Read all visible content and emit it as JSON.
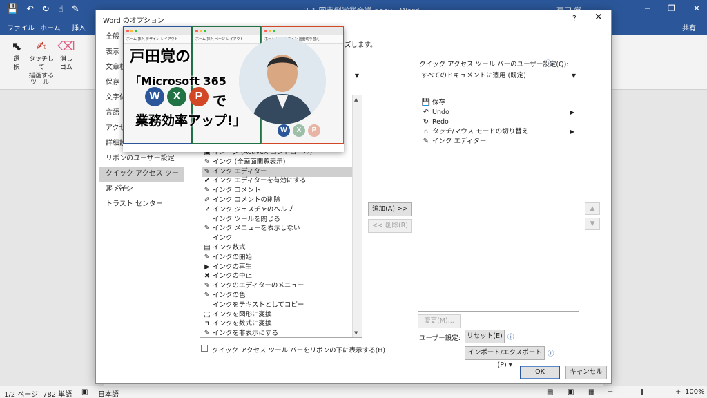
{
  "titlebar": {
    "doc_title": "3-1 回実例営業会議.docx - Word",
    "user_name": "戸田 覚",
    "minimize_icon": "─",
    "restore_icon": "❐",
    "close_icon": "✕"
  },
  "tabs": {
    "file": "ファイル",
    "home": "ホーム",
    "insert": "挿入",
    "share": "共有"
  },
  "ribbon": {
    "select_label": "選\n択",
    "draw_touch_label": "タッチして\n描画する",
    "eraser_label": "消し\nゴム",
    "group_tools": "ツール"
  },
  "statusbar": {
    "page": "1/2 ページ",
    "words": "782 単語",
    "lang": "日本語",
    "zoom": "100%"
  },
  "dialog": {
    "title": "Word のオプション",
    "help": "?",
    "close": "✕",
    "nav": [
      "全般",
      "表示",
      "文章校正",
      "保存",
      "文字体裁",
      "言語",
      "アクセシビリティ",
      "詳細設定",
      "リボンのユーザー設定",
      "クイック アクセス ツール バー",
      "アドイン",
      "トラスト センター"
    ],
    "nav_selected_index": 9,
    "header_text": "ズします。",
    "qat_settings_label": "クイック アクセス ツール バーのユーザー設定(Q):",
    "qat_scope_value": "すべてのドキュメントに適用 (既定)",
    "commands": [
      {
        "icon": "▣",
        "label": "イメージ (ActiveX コントロール)"
      },
      {
        "icon": "✎",
        "label": "インク (全画面閲覧表示)"
      },
      {
        "icon": "✎",
        "label": "インク エディター"
      },
      {
        "icon": "✔",
        "label": "インク エディターを有効にする"
      },
      {
        "icon": "✎",
        "label": "インク コメント"
      },
      {
        "icon": "✐",
        "label": "インク コメントの削除"
      },
      {
        "icon": "?",
        "label": "インク ジェスチャのヘルプ"
      },
      {
        "icon": "",
        "label": "インク ツールを閉じる"
      },
      {
        "icon": "✎",
        "label": "インク メニューを表示しない"
      },
      {
        "icon": "",
        "label": "インク"
      },
      {
        "icon": "▤",
        "label": "インク数式"
      },
      {
        "icon": "✎",
        "label": "インクの開始"
      },
      {
        "icon": "▶",
        "label": "インクの再生"
      },
      {
        "icon": "✖",
        "label": "インクの中止"
      },
      {
        "icon": "✎",
        "label": "インクのエディターのメニュー"
      },
      {
        "icon": "✎",
        "label": "インクの色"
      },
      {
        "icon": "",
        "label": "インクをテキストとしてコピー"
      },
      {
        "icon": "⬚",
        "label": "インクを図形に変換"
      },
      {
        "icon": "π",
        "label": "インクを数式に変換"
      },
      {
        "icon": "✎",
        "label": "インクを非表示にする"
      }
    ],
    "commands_selected_index": 2,
    "add_button": "追加(A) >>",
    "remove_button": "<< 削除(R)",
    "qat_items": [
      {
        "icon": "💾",
        "label": "保存"
      },
      {
        "icon": "↶",
        "label": "Undo"
      },
      {
        "icon": "↻",
        "label": "Redo"
      },
      {
        "icon": "☝",
        "label": "タッチ/マウス モードの切り替え"
      },
      {
        "icon": "✎",
        "label": "インク エディター"
      }
    ],
    "modify_button": "変更(M)...",
    "user_settings_label": "ユーザー設定:",
    "reset_button": "リセット(E) ▾",
    "import_export_button": "インポート/エクスポート(P) ▾",
    "checkbox_label": "クイック アクセス ツール バーをリボンの下に表示する(H)",
    "ok_button": "OK",
    "cancel_button": "キャンセル"
  },
  "overlay": {
    "line1": "戸田覚の",
    "line2": "「Microsoft 365",
    "line3": "で",
    "line4": "業務効率アップ!」",
    "badge_w": "W",
    "badge_x": "X",
    "badge_p": "P",
    "mini_tabs_1": "ホーム 挿入 デザイン レイアウト",
    "mini_tabs_2": "ホーム 挿入 ページ レイアウト",
    "mini_tabs_3": "ホーム 挿入 デザイン 画面切り替え",
    "colors": {
      "word": "#2b579a",
      "excel": "#217346",
      "ppt": "#d24726"
    }
  }
}
